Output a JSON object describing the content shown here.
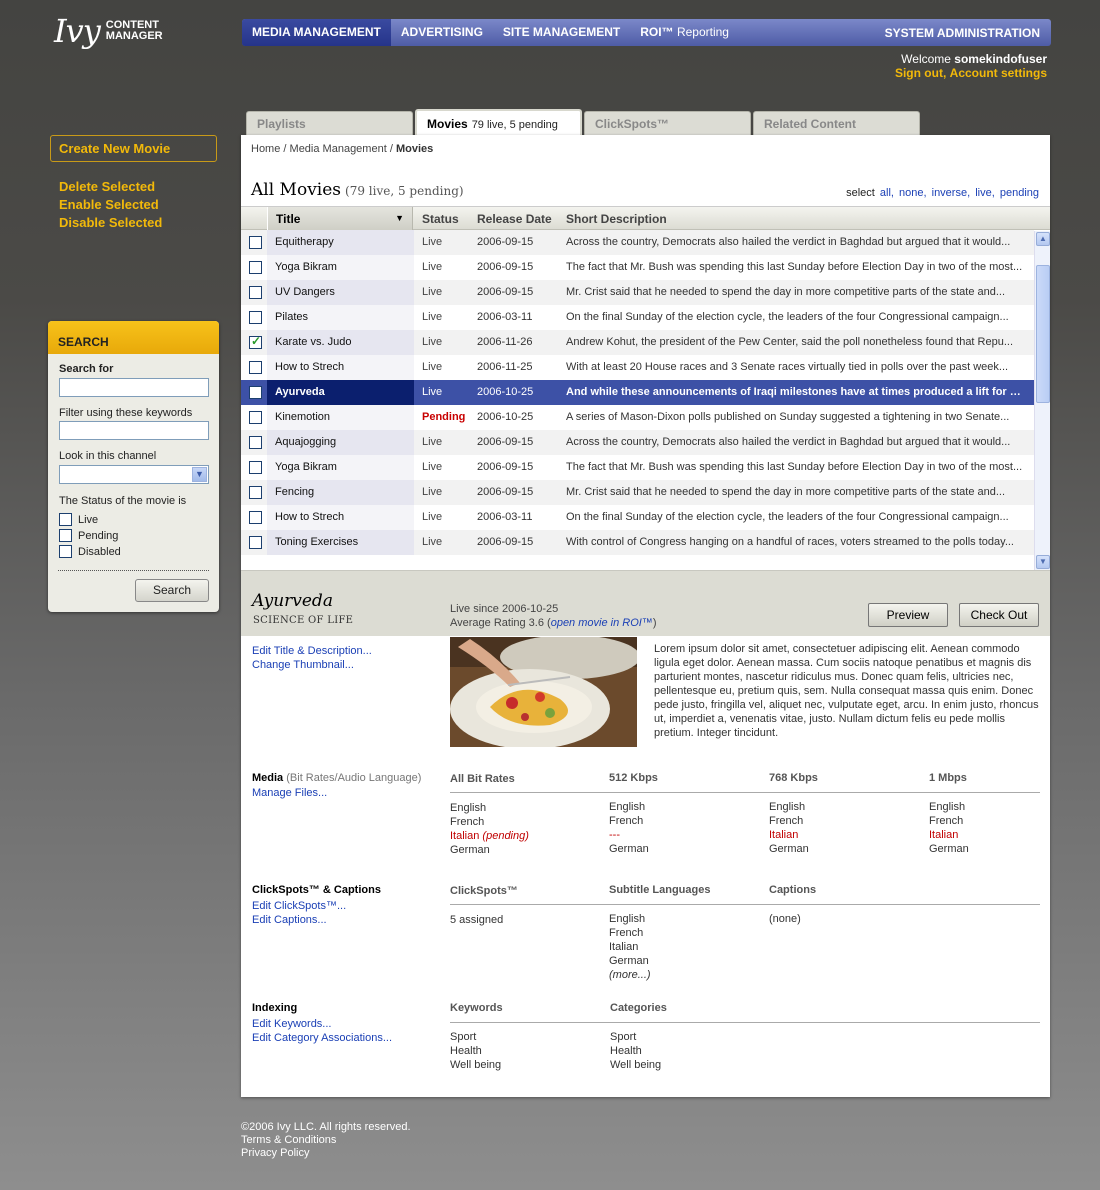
{
  "logo": {
    "mark": "Ivy",
    "line1": "CONTENT",
    "line2": "MANAGER"
  },
  "topnav": {
    "items": [
      "MEDIA MANAGEMENT",
      "ADVERTISING",
      "SITE MANAGEMENT"
    ],
    "roi_bold": "ROI™",
    "roi_rest": "Reporting",
    "sysadmin": "SYSTEM ADMINISTRATION"
  },
  "welcome": {
    "prefix": "Welcome",
    "user": "somekindofuser",
    "signout": "Sign out",
    "sep": ",",
    "account": "Account settings"
  },
  "left": {
    "create": "Create New Movie",
    "delete": "Delete Selected",
    "enable": "Enable Selected",
    "disable": "Disable Selected"
  },
  "search": {
    "heading": "SEARCH",
    "search_for": "Search for",
    "filter": "Filter using these keywords",
    "channel": "Look in this channel",
    "status_label": "The Status of the movie is",
    "opt_live": "Live",
    "opt_pending": "Pending",
    "opt_disabled": "Disabled",
    "button": "Search"
  },
  "tabs": {
    "playlists": "Playlists",
    "movies": "Movies",
    "movies_count": "79 live, 5 pending",
    "clickspots": "ClickSpots™",
    "related": "Related Content"
  },
  "breadcrumb": {
    "home": "Home",
    "sep1": "/",
    "media": "Media Management",
    "sep2": "/",
    "current": "Movies"
  },
  "list": {
    "title": "All Movies",
    "count": "(79 live, 5 pending)",
    "select_label": "select",
    "sel_all": "all,",
    "sel_none": "none,",
    "sel_inverse": "inverse,",
    "sel_live": "live,",
    "sel_pending": "pending",
    "headers": {
      "title": "Title",
      "status": "Status",
      "date": "Release Date",
      "desc": "Short Description"
    },
    "rows": [
      {
        "title": "Equitherapy",
        "status": "Live",
        "date": "2006-09-15",
        "desc": "Across the country, Democrats also hailed the verdict in Baghdad but argued that it would..."
      },
      {
        "title": "Yoga Bikram",
        "status": "Live",
        "date": "2006-09-15",
        "desc": "The fact that Mr. Bush was spending this last Sunday before Election Day in two of the most..."
      },
      {
        "title": "UV Dangers",
        "status": "Live",
        "date": "2006-09-15",
        "desc": "Mr. Crist said that he needed to spend the day in more competitive parts of the state and..."
      },
      {
        "title": "Pilates",
        "status": "Live",
        "date": "2006-03-11",
        "desc": "On the final Sunday of the election cycle, the leaders of the four Congressional campaign..."
      },
      {
        "title": "Karate vs. Judo",
        "status": "Live",
        "date": "2006-11-26",
        "desc": "Andrew Kohut, the president of the Pew Center, said the poll nonetheless found that Repu..."
      },
      {
        "title": "How to Strech",
        "status": "Live",
        "date": "2006-11-25",
        "desc": "With at least 20 House races and 3 Senate races virtually tied in polls over the past week..."
      },
      {
        "title": "Ayurveda",
        "status": "Live",
        "date": "2006-10-25",
        "desc": "And while these announcements of Iraqi milestones have at times produced a lift for Mr. ..."
      },
      {
        "title": "Kinemotion",
        "status": "Pending",
        "date": "2006-10-25",
        "desc": "A series of Mason-Dixon polls published on Sunday suggested a tightening in two Senate..."
      },
      {
        "title": "Aquajogging",
        "status": "Live",
        "date": "2006-09-15",
        "desc": "Across the country, Democrats also hailed the verdict in Baghdad but argued that it would..."
      },
      {
        "title": "Yoga Bikram",
        "status": "Live",
        "date": "2006-09-15",
        "desc": "The fact that Mr. Bush was spending this last Sunday before Election Day in two of the most..."
      },
      {
        "title": "Fencing",
        "status": "Live",
        "date": "2006-09-15",
        "desc": "Mr. Crist said that he needed to spend the day in more competitive parts of the state and..."
      },
      {
        "title": "How to Strech",
        "status": "Live",
        "date": "2006-03-11",
        "desc": "On the final Sunday of the election cycle, the leaders of the four Congressional campaign..."
      },
      {
        "title": "Toning Exercises",
        "status": "Live",
        "date": "2006-09-15",
        "desc": "With control of Congress hanging on a handful of races, voters streamed to the polls today..."
      }
    ]
  },
  "detail": {
    "title": "Ayurveda",
    "subtitle": "SCIENCE OF LIFE",
    "live_since": "Live since 2006-10-25",
    "rating_prefix": "Average Rating 3.6 (",
    "open_roi": "open movie in ROI™",
    "rating_suffix": ")",
    "preview": "Preview",
    "checkout": "Check Out",
    "edit_title": "Edit Title & Description...",
    "change_thumb": "Change Thumbnail...",
    "lorem": "Lorem ipsum dolor sit amet, consectetuer adipiscing elit. Aenean commodo ligula eget dolor. Aenean massa. Cum sociis natoque penatibus et magnis dis parturient montes, nascetur ridiculus mus. Donec quam felis, ultricies nec, pellentesque eu, pretium quis, sem. Nulla consequat massa quis enim. Donec pede justo, fringilla vel, aliquet nec, vulputate eget, arcu. In enim justo, rhoncus ut, imperdiet a, venenatis vitae, justo. Nullam dictum felis eu pede mollis pretium. Integer tincidunt.",
    "media": {
      "title": "Media",
      "title_muted": "(Bit Rates/Audio Language)",
      "manage": "Manage Files...",
      "cols": [
        "All Bit Rates",
        "512 Kbps",
        "768 Kbps",
        "1 Mbps"
      ],
      "all": {
        "l1": "English",
        "l2": "French",
        "l3a": "Italian",
        "l3b": "(pending)",
        "l4": "German"
      },
      "k512": {
        "l1": "English",
        "l2": "French",
        "l3": "---",
        "l4": "German"
      },
      "k768": {
        "l1": "English",
        "l2": "French",
        "l3": "Italian",
        "l4": "German"
      },
      "m1": {
        "l1": "English",
        "l2": "French",
        "l3": "Italian",
        "l4": "German"
      }
    },
    "clickspots": {
      "title": "ClickSpots™ & Captions",
      "edit_cs": "Edit ClickSpots™...",
      "edit_cap": "Edit Captions...",
      "cols": [
        "ClickSpots™",
        "Subtitle Languages",
        "Captions"
      ],
      "assigned": "5 assigned",
      "subs": [
        "English",
        "French",
        "Italian",
        "German"
      ],
      "more": "(more...)",
      "captions": "(none)"
    },
    "indexing": {
      "title": "Indexing",
      "edit_kw": "Edit Keywords...",
      "edit_cat": "Edit Category Associations...",
      "cols": [
        "Keywords",
        "Categories"
      ],
      "keywords": [
        "Sport",
        "Health",
        "Well being"
      ],
      "categories": [
        "Sport",
        "Health",
        "Well being"
      ]
    }
  },
  "footer": {
    "copyright": "©2006 Ivy LLC. All rights reserved.",
    "terms": "Terms & Conditions",
    "privacy": "Privacy Policy"
  }
}
